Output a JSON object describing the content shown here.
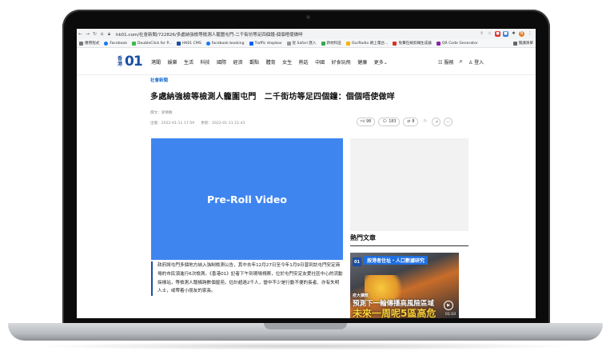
{
  "browser": {
    "url": "hk01.com/社會新聞/722826/多處納強檢等檢測人籠圍屯門-二千街坊等足四個鐘-個個唔使做咩",
    "bookmarks": [
      "應用程式",
      "Facebook",
      "DoubleClick for P...",
      "HK01 CMS",
      "facebook booking",
      "Traffic dropbox",
      "從 Safari 匯入",
      "新材料區",
      "OurRadio 網上電台...",
      "免費在線剪輯生成器",
      "QR Code Generator",
      "閱讀清單"
    ]
  },
  "site": {
    "logo_hk": "香港",
    "logo_01": "01",
    "menu": [
      "港聞",
      "娛樂",
      "生活",
      "科技",
      "國際",
      "經濟",
      "觀點",
      "體育",
      "女生",
      "熱話",
      "中國",
      "好食玩飛",
      "健康",
      "更多"
    ],
    "menu_more_arrow": "⌄",
    "services": "服務",
    "login": "登入"
  },
  "article": {
    "section": "社會新聞",
    "title": "多處納強檢等檢測人籠圍屯門　二千街坊等足四個鐘：個個唔使做咩",
    "author": "撰文：梁倩敏",
    "published": "出版：2022-01-11 17:59",
    "updated": "更新：2022-01-11 21:43",
    "likes": "98",
    "comments": "183",
    "shares": "8",
    "video_label": "Pre-Roll Video",
    "body": "政府將屯門多個地方納入強制檢測公告，其中去年12月27日至今年1月9日曾到訪屯門安定商場的市民須進行6次檢測。《香港01》記者下午到現場視察，位於屯門安定友愛社區中心的流動採樣站，等檢測人龍橫跨數個屋苑，估計超過2千人，當中不少是行動不便的長者、亦有失明人士，或帶着小朋友的家長。"
  },
  "sidebar": {
    "hot_title": "熱門文章",
    "thumb": {
      "logo": "01",
      "banner": "按港者住址・人口數據研究",
      "sub": "疫大擴散",
      "mid": "預測下一輪傳播高風險區域",
      "big": "未來一周呢5區高危",
      "time": "01:10"
    }
  },
  "colors": {
    "accent": "#1a4fa3",
    "video": "#3f85f0",
    "link": "#1a6fd1"
  }
}
